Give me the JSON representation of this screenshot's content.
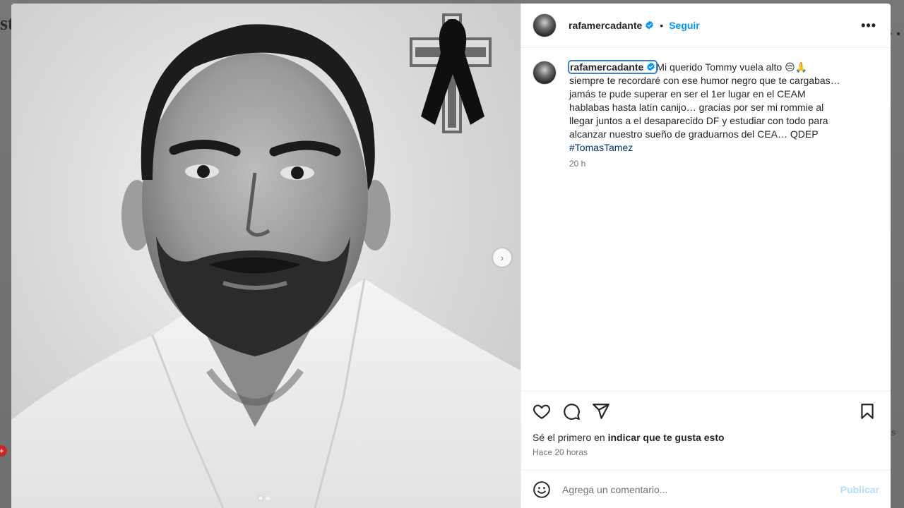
{
  "background": {
    "left_fragment": "st",
    "right_fragment": "• •",
    "badge": "+",
    "s_fragment": "s"
  },
  "post": {
    "username": "rafamercadante",
    "follow_label": "Seguir",
    "separator": "•",
    "more_label": "•••",
    "caption_lines": [
      "Mi querido Tommy vuela alto 😔🙏",
      "siempre te recordaré con ese humor negro que te cargabas…",
      "jamás te pude superar en ser el 1er lugar en el CEAM",
      "hablabas hasta latín canijo… gracias por ser mi rommie al",
      "llegar juntos a el desaparecido DF y estudiar con todo para",
      "alcanzar nuestro sueño de graduarnos del CEA… QDEP"
    ],
    "hashtag": "#TomasTamez",
    "caption_time": "20 h",
    "likes_prefix": "Sé el primero en ",
    "likes_bold": "indicar que te gusta esto",
    "post_time": "Hace 20 horas",
    "comment_placeholder": "Agrega un comentario...",
    "publish_label": "Publicar"
  },
  "carousel": {
    "next_label": "›",
    "slide_count": 2,
    "active_slide": 1
  },
  "icons": {
    "verified": "verified-badge-icon",
    "like": "heart-icon",
    "comment": "comment-bubble-icon",
    "share": "paper-plane-icon",
    "save": "bookmark-icon",
    "emoji": "smiley-icon"
  },
  "colors": {
    "accent": "#0095f6",
    "hashtag": "#00376b",
    "publish_disabled": "#b2dffc",
    "muted": "#737373"
  }
}
